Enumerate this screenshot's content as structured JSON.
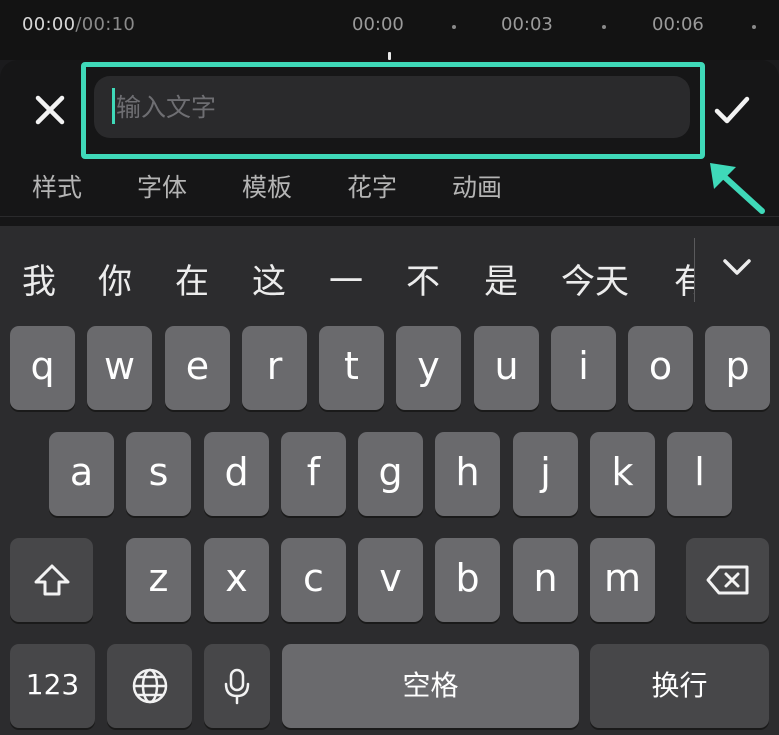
{
  "timeline": {
    "current_time": "00:00",
    "total_time": "/00:10",
    "marks": [
      "00:00",
      "00:03",
      "00:06"
    ]
  },
  "editor": {
    "input_placeholder": "输入文字",
    "input_value": "",
    "tabs": [
      "样式",
      "字体",
      "模板",
      "花字",
      "动画"
    ]
  },
  "keyboard": {
    "candidates": [
      "我",
      "你",
      "在",
      "这",
      "一",
      "不",
      "是",
      "今天",
      "有"
    ],
    "row1": [
      "q",
      "w",
      "e",
      "r",
      "t",
      "y",
      "u",
      "i",
      "o",
      "p"
    ],
    "row2": [
      "a",
      "s",
      "d",
      "f",
      "g",
      "h",
      "j",
      "k",
      "l"
    ],
    "row3": [
      "z",
      "x",
      "c",
      "v",
      "b",
      "n",
      "m"
    ],
    "numbers_label": "123",
    "space_label": "空格",
    "return_label": "换行"
  },
  "colors": {
    "accent": "#3fd9b9",
    "key": "#6a6a6d",
    "key_dark": "#474749",
    "keyboard_bg": "#2c2c2e"
  },
  "icons": {
    "close": "close-icon",
    "confirm": "checkmark-icon",
    "annotation": "arrow-icon",
    "expand": "chevron-down-icon",
    "shift": "shift-icon",
    "delete": "backspace-icon",
    "globe": "globe-icon",
    "mic": "microphone-icon"
  }
}
